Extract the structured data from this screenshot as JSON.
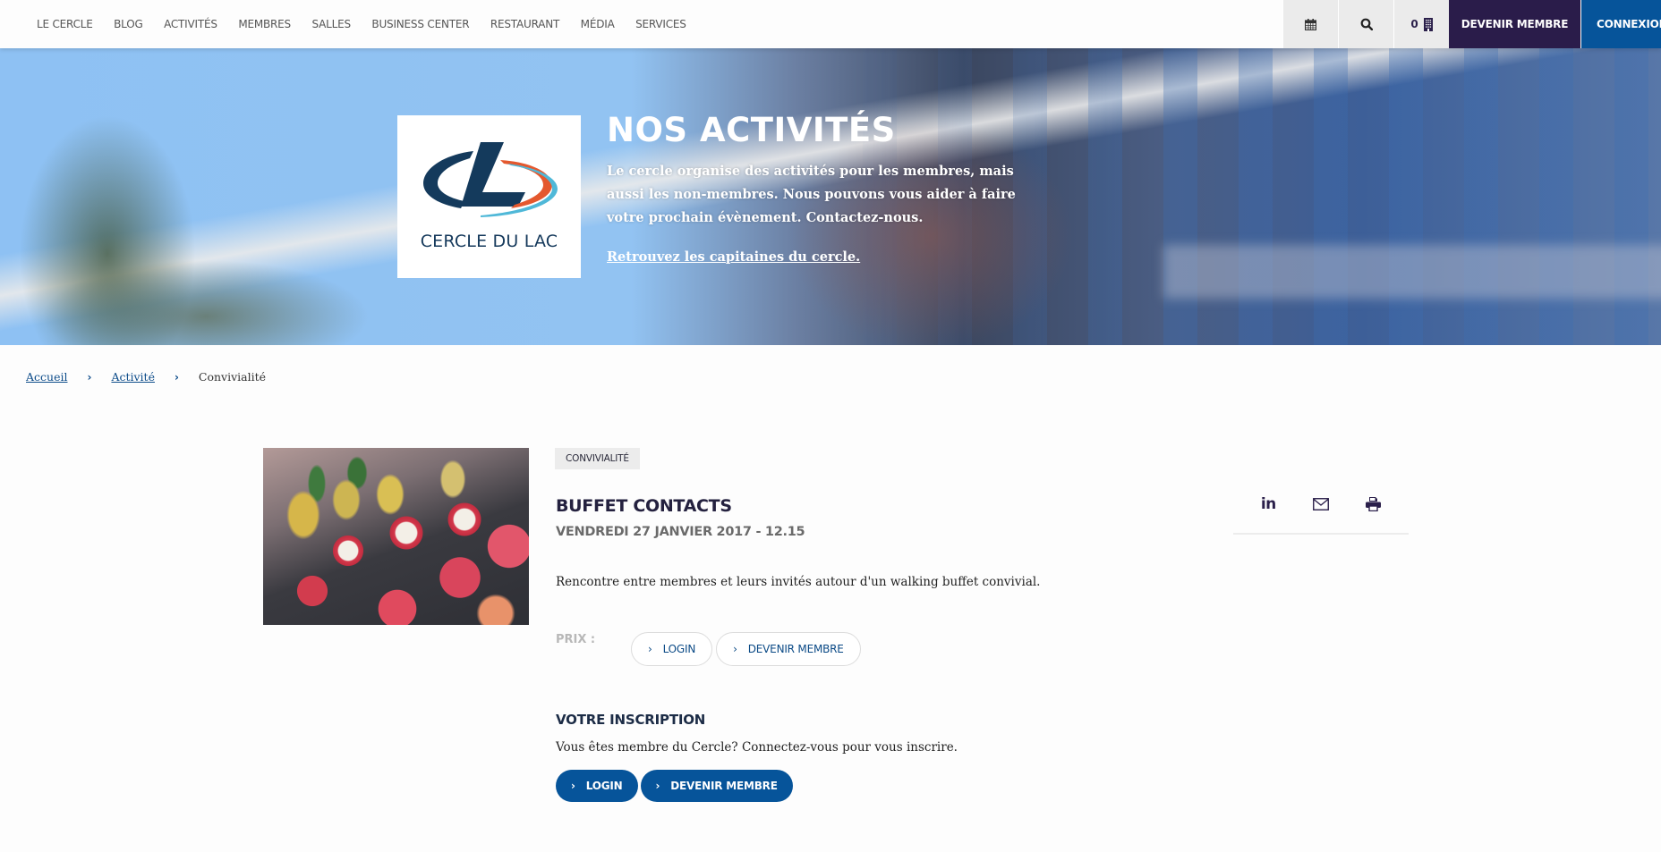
{
  "header": {
    "nav": [
      "LE CERCLE",
      "BLOG",
      "ACTIVITÉS",
      "MEMBRES",
      "SALLES",
      "BUSINESS CENTER",
      "RESTAURANT",
      "MÉDIA",
      "SERVICES"
    ],
    "icons": {
      "calendar": "calendar-icon",
      "search": "search-icon",
      "cart": "building-icon"
    },
    "cart_count": "0",
    "devenir_membre": "DEVENIR MEMBRE",
    "connexion": "CONNEXION",
    "colors": {
      "devenir_bg": "#2a1c4a",
      "connexion_bg": "#06549a"
    }
  },
  "hero": {
    "logo_text": "CERCLE DU LAC",
    "title": "NOS ACTIVITÉS",
    "text": "Le cercle organise des activités pour les membres, mais aussi les non-membres. Nous pouvons vous aider à faire votre prochain évènement. Contactez-nous.",
    "link": "Retrouvez les capitaines du cercle."
  },
  "breadcrumb": {
    "items": [
      {
        "label": "Accueil"
      },
      {
        "label": "Activité"
      }
    ],
    "current": "Convivialité",
    "separator": "›"
  },
  "event": {
    "tag": "CONVIVIALITÉ",
    "title": "BUFFET CONTACTS",
    "date": "VENDREDI 27 JANVIER 2017 - 12.15",
    "description": "Rencontre entre membres et leurs invités autour d'un walking buffet convivial.",
    "prix_label": "PRIX :",
    "prix_buttons": [
      "LOGIN",
      "DEVENIR MEMBRE"
    ],
    "inscription": {
      "title": "VOTRE INSCRIPTION",
      "text": "Vous êtes membre du Cercle? Connectez-vous pour vous inscrire.",
      "buttons": [
        "LOGIN",
        "DEVENIR MEMBRE"
      ]
    }
  },
  "share": {
    "linkedin": "in",
    "icons": [
      "linkedin-icon",
      "mail-icon",
      "print-icon"
    ]
  }
}
